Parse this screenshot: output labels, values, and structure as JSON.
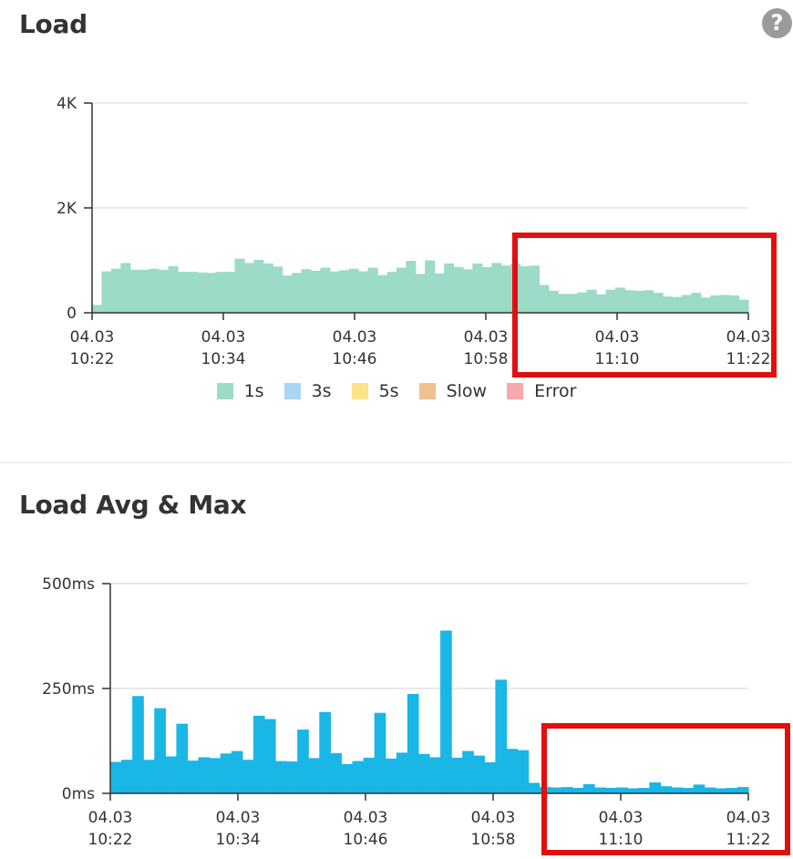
{
  "panels": {
    "load": {
      "title": "Load"
    },
    "avg": {
      "title": "Load Avg & Max"
    }
  },
  "help_icon": {
    "glyph": "?"
  },
  "colors": {
    "load_bar": "#9bdbc7",
    "avg_bar": "#19b6e6",
    "highlight": "#e01010",
    "axis": "#333333",
    "grid": "#e3e3e3"
  },
  "legend": [
    {
      "label": "1s",
      "color": "#9bdbc7"
    },
    {
      "label": "3s",
      "color": "#a9d6f4"
    },
    {
      "label": "5s",
      "color": "#fce389"
    },
    {
      "label": "Slow",
      "color": "#f0c08f"
    },
    {
      "label": "Error",
      "color": "#f6a8ad"
    }
  ],
  "chart_data": [
    {
      "type": "bar",
      "title": "Load",
      "grid": true,
      "legend_placement": "bottom",
      "x_tick_labels": [
        [
          "04.03",
          "10:22"
        ],
        [
          "04.03",
          "10:34"
        ],
        [
          "04.03",
          "10:46"
        ],
        [
          "04.03",
          "10:58"
        ],
        [
          "04.03",
          "11:10"
        ],
        [
          "04.03",
          "11:22"
        ]
      ],
      "y_tick_labels": [
        "0",
        "2K",
        "4K"
      ],
      "y_ticks": [
        0,
        2000,
        4000
      ],
      "xlim": [
        "10:22",
        "11:22"
      ],
      "ylim": [
        0,
        4000
      ],
      "series": [
        {
          "name": "1s",
          "values": [
            150,
            790,
            840,
            950,
            820,
            820,
            840,
            820,
            890,
            780,
            780,
            770,
            760,
            780,
            780,
            1030,
            950,
            1010,
            940,
            880,
            710,
            760,
            830,
            800,
            860,
            790,
            810,
            840,
            790,
            860,
            720,
            780,
            860,
            990,
            740,
            1000,
            750,
            940,
            870,
            830,
            940,
            870,
            950,
            900,
            940,
            890,
            900,
            530,
            420,
            360,
            360,
            390,
            440,
            350,
            440,
            480,
            430,
            420,
            430,
            380,
            310,
            300,
            340,
            380,
            290,
            330,
            340,
            330,
            250
          ]
        }
      ]
    },
    {
      "type": "bar",
      "title": "Load Avg & Max",
      "grid": true,
      "x_tick_labels": [
        [
          "04.03",
          "10:22"
        ],
        [
          "04.03",
          "10:34"
        ],
        [
          "04.03",
          "10:46"
        ],
        [
          "04.03",
          "10:58"
        ],
        [
          "04.03",
          "11:10"
        ],
        [
          "04.03",
          "11:22"
        ]
      ],
      "y_tick_labels": [
        "0ms",
        "250ms",
        "500ms"
      ],
      "y_ticks": [
        0,
        250,
        500
      ],
      "xlim": [
        "10:22",
        "11:22"
      ],
      "ylim": [
        0,
        500
      ],
      "series": [
        {
          "values": [
            75,
            80,
            232,
            80,
            203,
            88,
            166,
            78,
            86,
            84,
            95,
            101,
            80,
            185,
            177,
            77,
            76,
            152,
            84,
            194,
            96,
            70,
            77,
            85,
            192,
            83,
            97,
            237,
            94,
            86,
            388,
            85,
            101,
            90,
            74,
            271,
            106,
            103,
            25,
            15,
            14,
            15,
            13,
            22,
            14,
            13,
            14,
            12,
            13,
            26,
            17,
            14,
            13,
            21,
            14,
            12,
            13,
            15
          ]
        }
      ]
    }
  ]
}
